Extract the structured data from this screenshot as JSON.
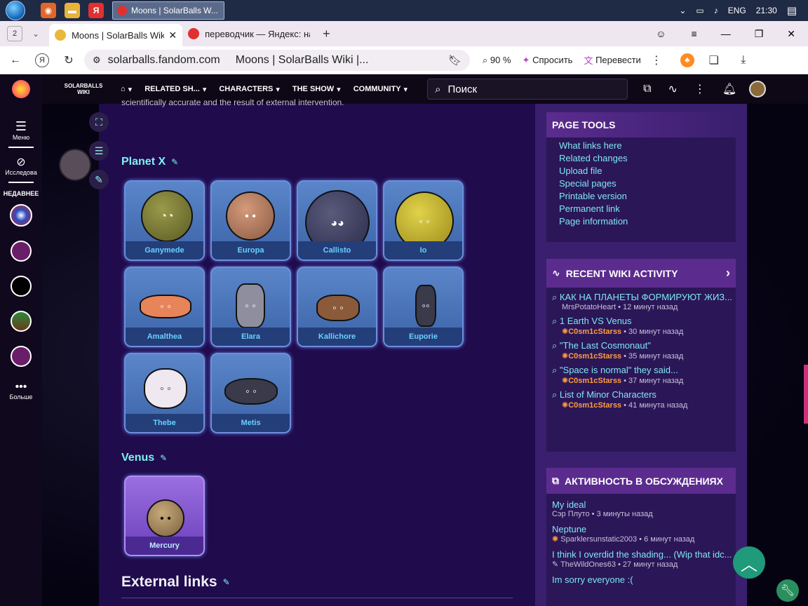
{
  "taskbar": {
    "task_title": "Moons | SolarBalls W...",
    "lang": "ENG",
    "time": "21:30"
  },
  "tabs": {
    "count": "2",
    "active": "Moons | SolarBalls Wiki",
    "other": "переводчик — Яндекс: на"
  },
  "address": {
    "host": "solarballs.fandom.com",
    "page_title": "Moons | SolarBalls Wiki |...",
    "zoom": "90 %",
    "ask": "Спросить",
    "translate": "Перевести"
  },
  "rail": {
    "menu": "Меню",
    "explore": "Исследова",
    "recent": "НЕДАВНЕЕ",
    "more": "Больше"
  },
  "nav": {
    "logo": "SOLARBALLS WIKI",
    "items": [
      "RELATED SH...",
      "CHARACTERS",
      "THE SHOW",
      "COMMUNITY"
    ],
    "search_placeholder": "Поиск"
  },
  "content": {
    "intro": "scientifically accurate and the result of external intervention.",
    "sections": [
      {
        "title": "Planet X",
        "cards": [
          "Ganymede",
          "Europa",
          "Callisto",
          "Io",
          "Amalthea",
          "Elara",
          "Kallichore",
          "Euporie",
          "Thebe",
          "Metis"
        ]
      },
      {
        "title": "Venus",
        "cards": [
          "Mercury"
        ]
      }
    ],
    "external": "External links"
  },
  "page_tools": {
    "title": "PAGE TOOLS",
    "links": [
      "What links here",
      "Related changes",
      "Upload file",
      "Special pages",
      "Printable version",
      "Permanent link",
      "Page information"
    ]
  },
  "recent_activity": {
    "title": "RECENT WIKI ACTIVITY",
    "items": [
      {
        "title": "КАК НА ПЛАНЕТЫ ФОРМИРУЮТ ЖИЗ...",
        "user": "MrsPotatoHeart",
        "time": "12 минут назад"
      },
      {
        "title": "1 Earth VS Venus",
        "user": "C0sm1cStarss",
        "time": "30 минут назад"
      },
      {
        "title": "\"The Last Cosmonaut\"",
        "user": "C0sm1cStarss",
        "time": "35 минут назад"
      },
      {
        "title": "\"Space is normal\" they said...",
        "user": "C0sm1cStarss",
        "time": "37 минут назад"
      },
      {
        "title": "List of Minor Characters",
        "user": "C0sm1cStarss",
        "time": "41 минута назад"
      }
    ]
  },
  "discussions": {
    "title": "АКТИВНОСТЬ В ОБСУЖДЕНИЯХ",
    "items": [
      {
        "title": "My ideal",
        "user": "Сэр Плуто",
        "time": "3 минуты назад"
      },
      {
        "title": "Neptune",
        "user": "Sparklersunstatic2003",
        "time": "6 минут назад"
      },
      {
        "title": "I think I overdid the shading... (Wip that idc...",
        "user": "TheWildOnes63",
        "time": "27 минут назад"
      },
      {
        "title": "Im sorry everyone :(",
        "user": "",
        "time": ""
      }
    ]
  }
}
